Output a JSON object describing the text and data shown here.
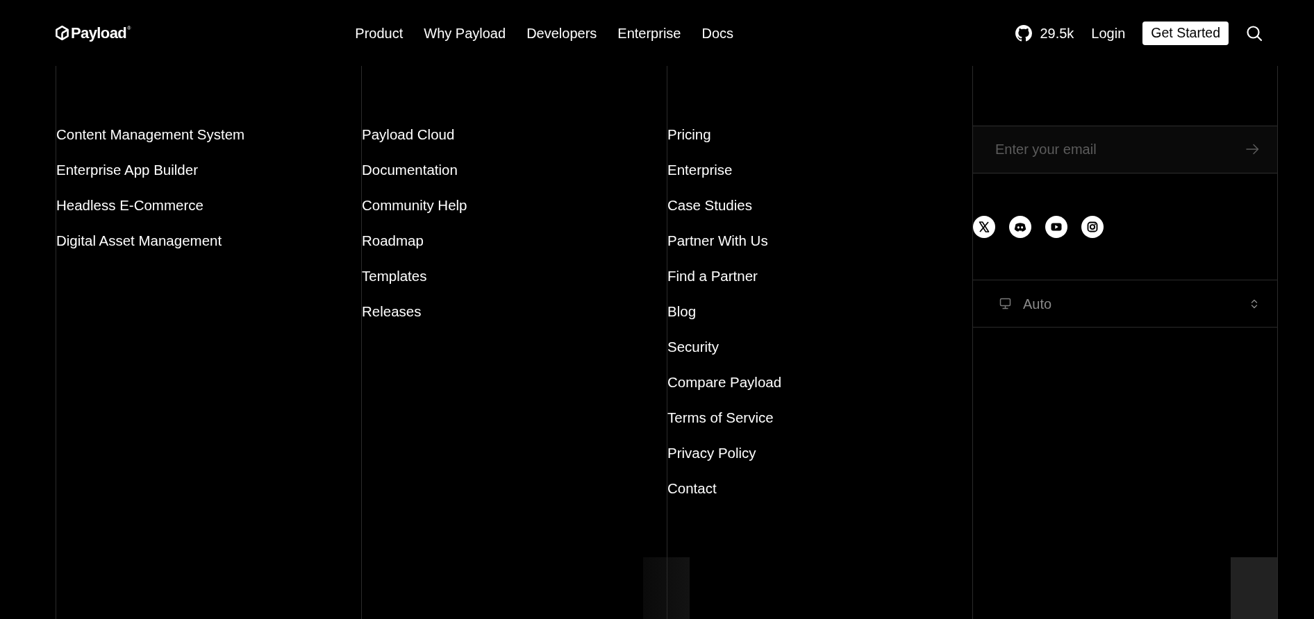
{
  "header": {
    "logo": "Payload$^{®}$",
    "nav": [
      "Product",
      "Why Payload",
      "Developers",
      "Enterprise",
      "Docs"
    ],
    "github_stars": "29.5k",
    "login": "Login",
    "cta": "Get Started"
  },
  "footer": {
    "columns": [
      {
        "links": [
          "Content Management System",
          "Enterprise App Builder",
          "Headless E-Commerce",
          "Digital Asset Management"
        ]
      },
      {
        "links": [
          "Payload Cloud",
          "Documentation",
          "Community Help",
          "Roadmap",
          "Templates",
          "Releases"
        ]
      },
      {
        "links": [
          "Pricing",
          "Enterprise",
          "Case Studies",
          "Partner With Us",
          "Find a Partner",
          "Blog",
          "Security",
          "Compare Payload",
          "Terms of Service",
          "Privacy Policy",
          "Contact"
        ]
      }
    ],
    "newsletter": {
      "placeholder": "Enter your email"
    },
    "theme_select": {
      "value": "Auto"
    }
  }
}
